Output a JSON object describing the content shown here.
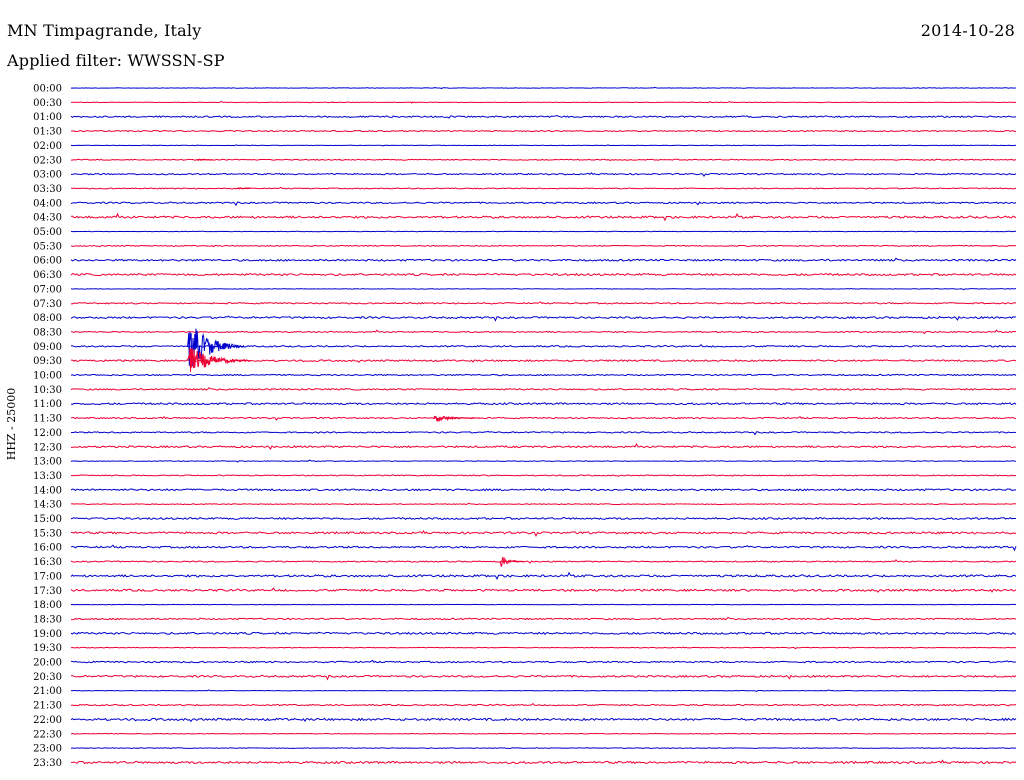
{
  "header": {
    "station": "MN Timpagrande, Italy",
    "date": "2014-10-28",
    "filter": "Applied filter: WWSSN-SP"
  },
  "chart_data": {
    "type": "line",
    "title": "MN Timpagrande, Italy",
    "ylabel": "HHZ - 25000",
    "colors": [
      "#0000cc",
      "#ee0033"
    ],
    "row_labels": [
      "00:00",
      "00:30",
      "01:00",
      "01:30",
      "02:00",
      "02:30",
      "03:00",
      "03:30",
      "04:00",
      "04:30",
      "05:00",
      "05:30",
      "06:00",
      "06:30",
      "07:00",
      "07:30",
      "08:00",
      "08:30",
      "09:00",
      "09:30",
      "10:00",
      "10:30",
      "11:00",
      "11:30",
      "12:00",
      "12:30",
      "13:00",
      "13:30",
      "14:00",
      "14:30",
      "15:00",
      "15:30",
      "16:00",
      "16:30",
      "17:00",
      "17:30",
      "18:00",
      "18:30",
      "19:00",
      "19:30",
      "20:00",
      "20:30",
      "21:00",
      "21:30",
      "22:00",
      "22:30",
      "23:00",
      "23:30"
    ],
    "noise_level": [
      0.3,
      0.3,
      0.9,
      0.7,
      0.3,
      0.6,
      0.8,
      0.6,
      0.9,
      1.3,
      0.3,
      0.6,
      1.1,
      1.2,
      0.3,
      0.8,
      1.1,
      0.7,
      0.9,
      1.0,
      0.8,
      0.9,
      1.1,
      0.8,
      0.8,
      1.1,
      0.4,
      0.6,
      1.1,
      0.5,
      1.1,
      1.2,
      1.1,
      0.7,
      1.3,
      1.2,
      0.3,
      0.9,
      1.2,
      0.4,
      0.9,
      1.1,
      0.3,
      0.8,
      1.3,
      0.4,
      0.4,
      1.3
    ],
    "events": [
      {
        "row": 18,
        "start_min": 3.7,
        "duration_min": 1.8,
        "amplitude": 1.8
      },
      {
        "row": 19,
        "start_min": 3.7,
        "duration_min": 2.0,
        "amplitude": 1.0
      },
      {
        "row": 23,
        "start_min": 11.5,
        "duration_min": 1.5,
        "amplitude": 0.25
      },
      {
        "row": 33,
        "start_min": 13.6,
        "duration_min": 0.8,
        "amplitude": 0.45
      },
      {
        "row": 5,
        "start_min": 4.0,
        "duration_min": 0.5,
        "amplitude": 0.08
      },
      {
        "row": 7,
        "start_min": 5.3,
        "duration_min": 0.4,
        "amplitude": 0.08
      },
      {
        "row": 1,
        "start_min": 8.3,
        "duration_min": 0.05,
        "amplitude": 0.1
      },
      {
        "row": 1,
        "start_min": 10.8,
        "duration_min": 0.05,
        "amplitude": 0.1
      }
    ]
  }
}
